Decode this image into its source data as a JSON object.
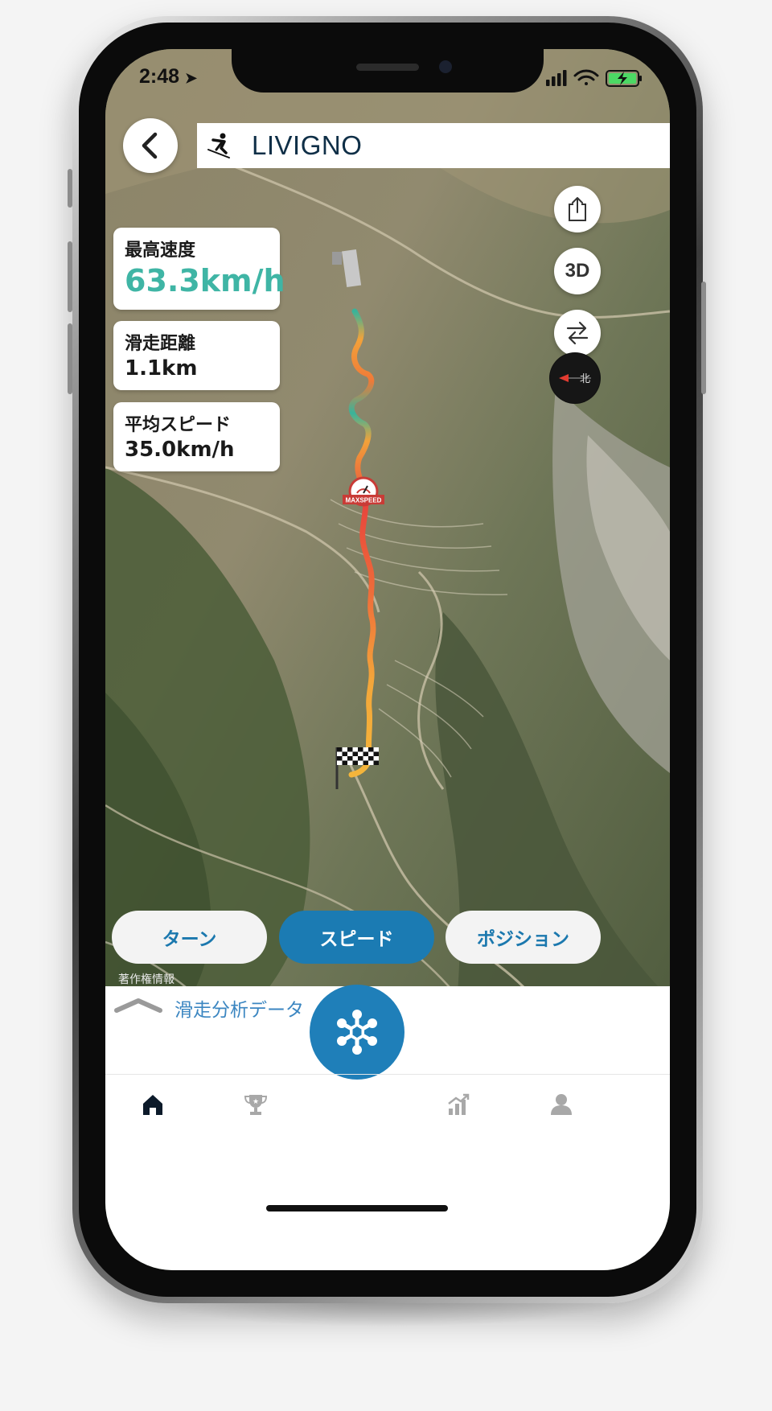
{
  "status_bar": {
    "time": "2:48"
  },
  "header": {
    "title": "LIVIGNO"
  },
  "icons": {
    "back": "chevron-left-icon",
    "sport": "skier-icon",
    "share": "share-icon",
    "swap": "swap-arrows-icon",
    "compass": "compass-icon",
    "max_speed_marker": "max-speed-badge-icon",
    "finish_marker": "checkered-flag-icon",
    "fab": "snowflake-icon"
  },
  "map_controls": {
    "view_3d_label": "3D"
  },
  "stats": {
    "max_speed": {
      "label": "最高速度",
      "value": "63.3km/h"
    },
    "distance": {
      "label": "滑走距離",
      "value": "1.1km"
    },
    "avg_speed": {
      "label": "平均スピード",
      "value": "35.0km/h"
    }
  },
  "map": {
    "max_speed_badge": "MAXSPEED",
    "copyright": "著作権情報"
  },
  "segments": {
    "turn": "ターン",
    "speed": "スピード",
    "position": "ポジション",
    "selected": "スピード"
  },
  "analysis_panel": {
    "label": "滑走分析データ"
  },
  "tabbar": {
    "items": [
      "home-icon",
      "trophy-icon",
      "stats-icon",
      "profile-icon"
    ],
    "active": "home-icon"
  },
  "colors": {
    "accent_teal": "#3fb5a5",
    "primary_blue": "#1b7bb3",
    "link_blue": "#3b86c1",
    "title_navy": "#0f2f47"
  }
}
